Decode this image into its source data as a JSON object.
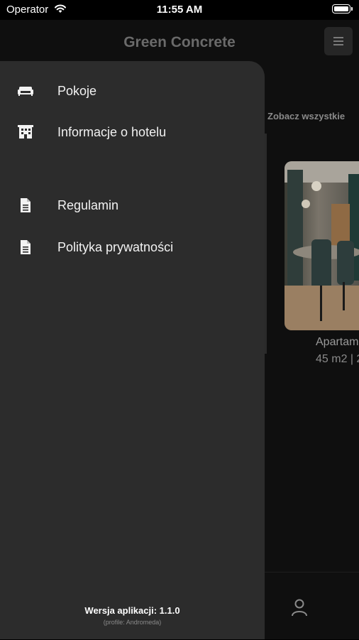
{
  "status_bar": {
    "carrier": "Operator",
    "time": "11:55 AM"
  },
  "header": {
    "title": "Green Concrete",
    "menu_icon": "hamburger-icon"
  },
  "main": {
    "see_all": "Zobacz wszystkie",
    "card": {
      "name": "Apartam",
      "info": "45 m2 | 2"
    }
  },
  "tabbar": {
    "profile_icon": "user-icon"
  },
  "drawer": {
    "items": [
      {
        "label": "Pokoje",
        "icon": "sofa-icon"
      },
      {
        "label": "Informacje o hotelu",
        "icon": "building-icon"
      },
      {
        "label": "Regulamin",
        "icon": "document-icon"
      },
      {
        "label": "Polityka prywatności",
        "icon": "document-icon"
      }
    ],
    "version": "Wersja aplikacji: 1.1.0",
    "profile_note": "(profile: Andromeda)"
  }
}
